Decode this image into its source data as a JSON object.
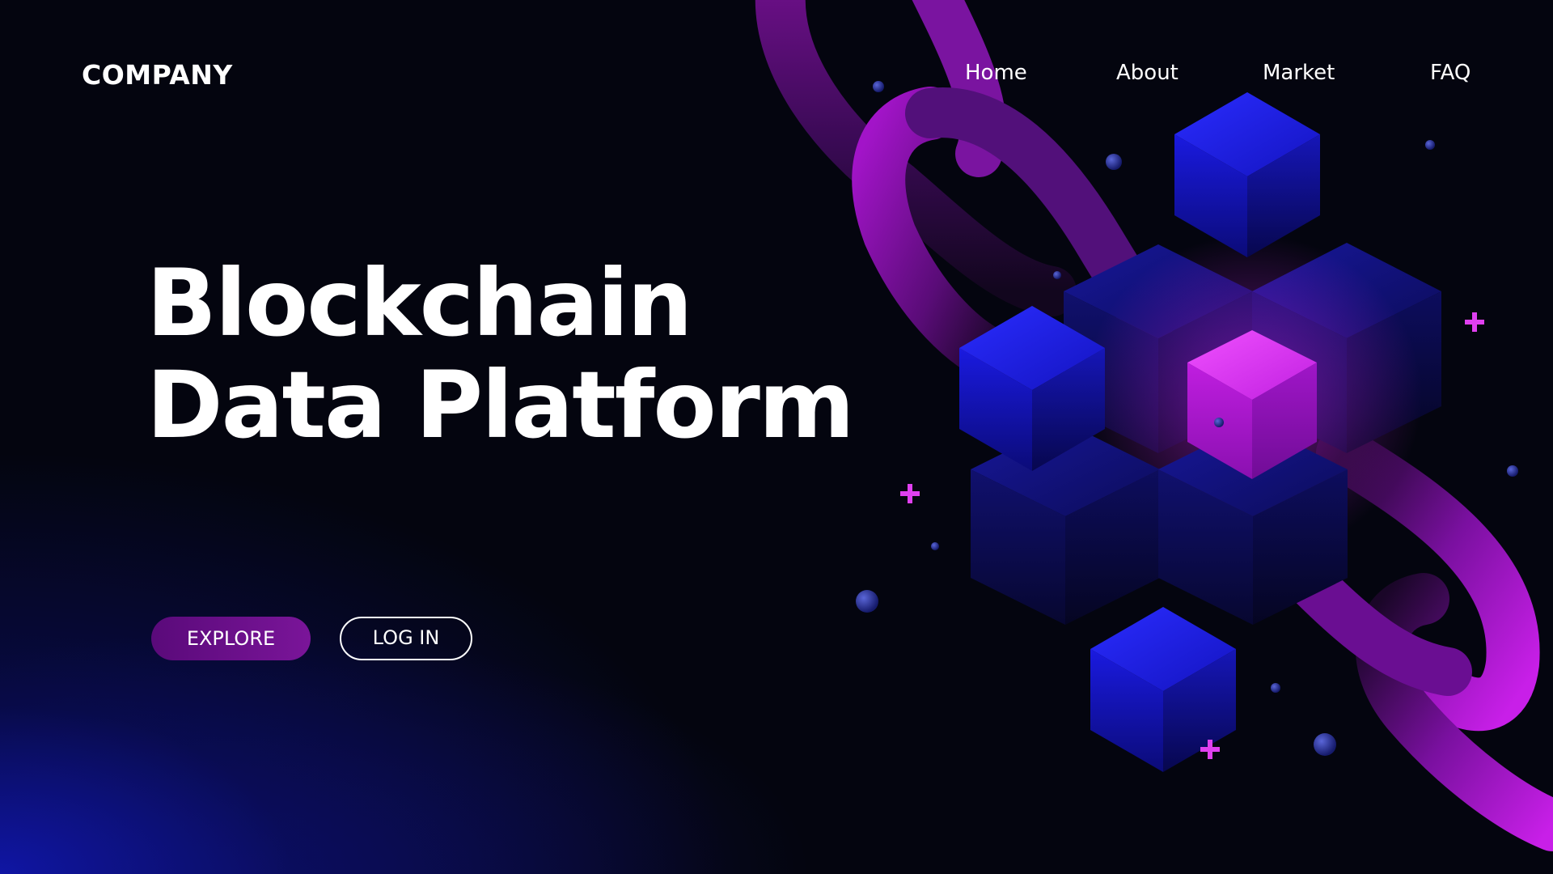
{
  "brand": {
    "name": "COMPANY"
  },
  "nav": {
    "items": [
      {
        "label": "Home"
      },
      {
        "label": "About"
      },
      {
        "label": "Market"
      },
      {
        "label": "FAQ"
      }
    ]
  },
  "hero": {
    "title_line1": "Blockchain",
    "title_line2": "Data Platform",
    "explore_label": "EXPLORE",
    "login_label": "LOG IN"
  },
  "colors": {
    "background": "#04050f",
    "accent_purple": "#7a1599",
    "cube_blue": "#1a1ad8",
    "cube_magenta": "#c020e0"
  }
}
